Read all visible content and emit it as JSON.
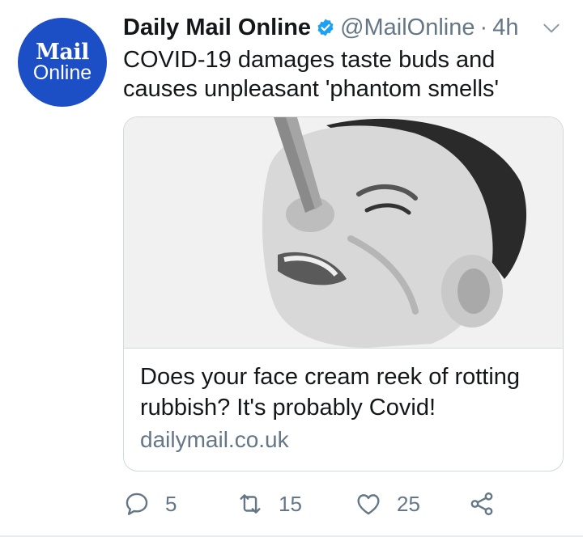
{
  "author": {
    "avatar_line1": "Mail",
    "avatar_line2": "Online",
    "name": "Daily Mail Online",
    "handle": "@MailOnline",
    "separator": "·",
    "time": "4h",
    "verified": true
  },
  "tweet": {
    "text": "COVID-19 damages taste buds and causes unpleasant 'phantom smells'"
  },
  "card": {
    "image_description_icon": "boy-with-clothespeg-on-nose-photo",
    "title": "Does your face cream reek of rotting rubbish? It's probably Covid!",
    "domain": "dailymail.co.uk"
  },
  "actions": {
    "reply_count": "5",
    "retweet_count": "15",
    "like_count": "25"
  },
  "colors": {
    "avatar_bg": "#1c4fc6",
    "verified_blue": "#1da1f2",
    "muted_gray": "#657786",
    "border": "#cfd9de"
  }
}
